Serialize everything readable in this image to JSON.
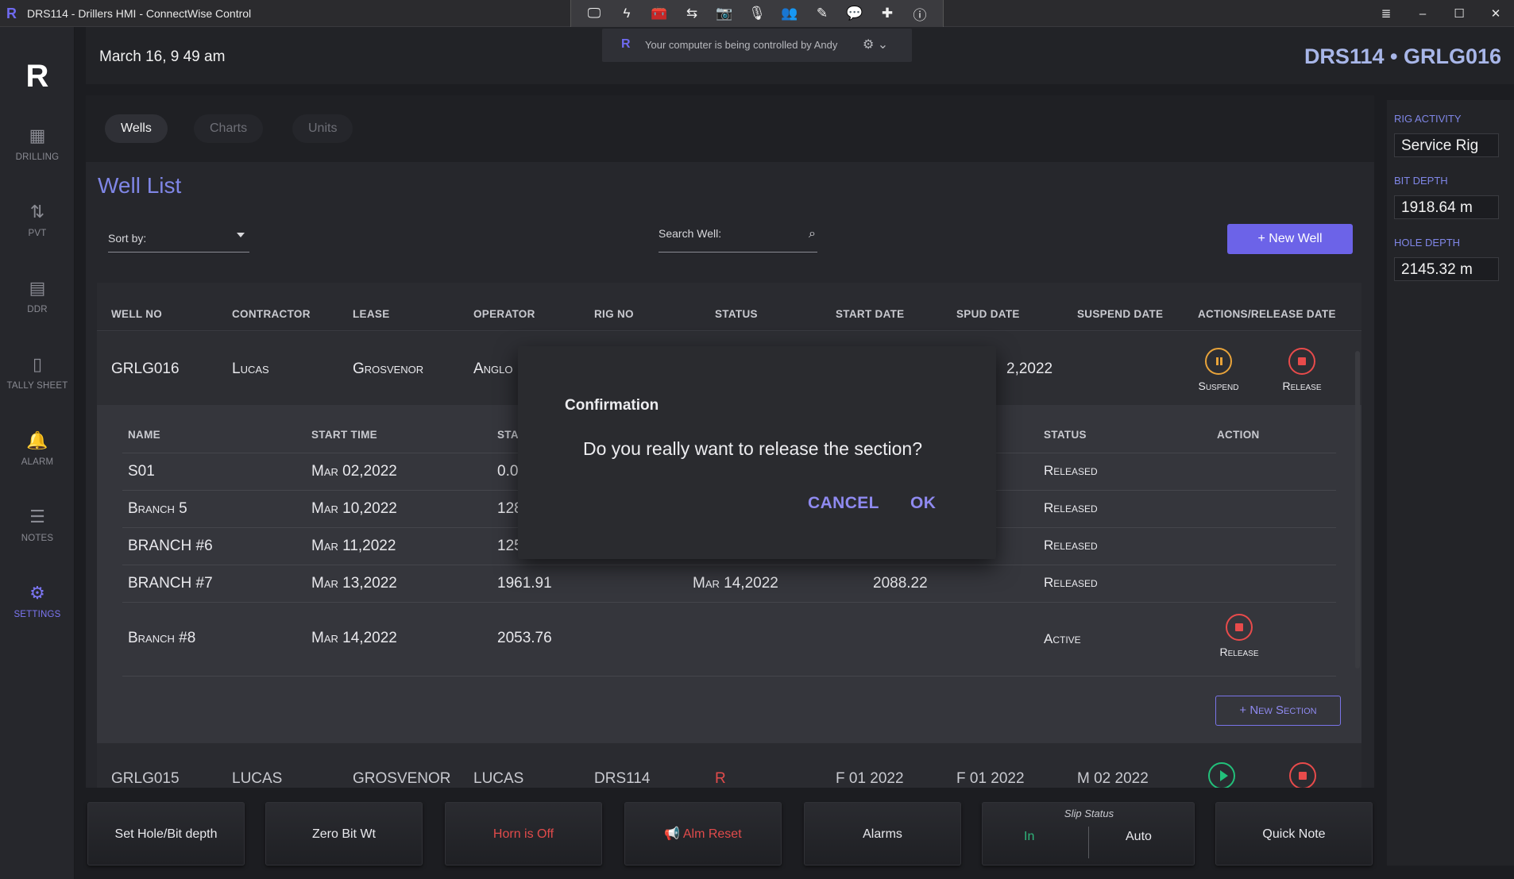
{
  "window": {
    "logo": "R",
    "title": "DRS114 - Drillers HMI - ConnectWise Control"
  },
  "cw_toolbar": {
    "icons": [
      "monitor-icon",
      "lightning-icon",
      "toolbox-icon",
      "transfer-icon",
      "camera-icon",
      "microphone-icon",
      "users-icon",
      "pencil-icon",
      "chat-icon",
      "plus-cross-icon",
      "info-icon"
    ]
  },
  "window_controls": {
    "menu": "≣",
    "minimize": "–",
    "maximize": "☐",
    "close": "✕"
  },
  "cw_banner": {
    "logo": "R",
    "text": "Your computer is being controlled by Andy",
    "gear": "⚙ ⌄"
  },
  "nav": {
    "brand": "R",
    "items": [
      {
        "label": "DRILLING",
        "icon": "▦"
      },
      {
        "label": "PVT",
        "icon": "⇅"
      },
      {
        "label": "DDR",
        "icon": "▤"
      },
      {
        "label": "TALLY SHEET",
        "icon": "▯"
      },
      {
        "label": "ALARM",
        "icon": "🔔"
      },
      {
        "label": "NOTES",
        "icon": "☰"
      },
      {
        "label": "SETTINGS",
        "icon": "⚙"
      }
    ]
  },
  "header": {
    "date": "March 16, 9 49 am",
    "rig_well": "DRS114 • GRLG016"
  },
  "tabs": [
    "Wells",
    "Charts",
    "Units"
  ],
  "page": {
    "title": "Well List",
    "sort_label": "Sort by:",
    "search_label": "Search Well:",
    "search_icon": "⌕",
    "new_well": "+ New Well"
  },
  "well_table": {
    "columns": [
      "WELL NO",
      "CONTRACTOR",
      "LEASE",
      "OPERATOR",
      "RIG NO",
      "STATUS",
      "START DATE",
      "SPUD DATE",
      "SUSPEND DATE",
      "ACTIONS/RELEASE DATE"
    ],
    "well": {
      "well_no": "GRLG016",
      "contractor": "Lucas",
      "lease": "Grosvenor",
      "operator": "Anglo",
      "spud_partial": "2,2022"
    },
    "actions": {
      "suspend": "Suspend",
      "release": "Release"
    }
  },
  "sections": {
    "columns": [
      "NAME",
      "START TIME",
      "STAR",
      "STATUS",
      "ACTION"
    ],
    "rows": [
      {
        "name": "S01",
        "start_time": "Mar 02,2022",
        "start_depth": "0.0",
        "end_time": "",
        "end_depth": "",
        "status": "Released"
      },
      {
        "name": "Branch 5",
        "start_time": "Mar 10,2022",
        "start_depth": "128",
        "end_time": "",
        "end_depth": "",
        "status": "Released"
      },
      {
        "name": "BRANCH #6",
        "start_time": "Mar 11,2022",
        "start_depth": "125",
        "end_time": "",
        "end_depth": "",
        "status": "Released"
      },
      {
        "name": "BRANCH #7",
        "start_time": "Mar 13,2022",
        "start_depth": "1961.91",
        "end_time": "Mar 14,2022",
        "end_depth": "2088.22",
        "status": "Released"
      },
      {
        "name": "Branch #8",
        "start_time": "Mar 14,2022",
        "start_depth": "2053.76",
        "end_time": "",
        "end_depth": "",
        "status": "Active"
      }
    ],
    "row_action_release": "Release",
    "new_section": "+ New Section"
  },
  "next_well_partial": [
    "GRLG015",
    "LUCAS",
    "GROSVENOR",
    "LUCAS",
    "DRS114",
    "R",
    "F 01 2022",
    "F 01 2022",
    "M 02 2022"
  ],
  "dialog": {
    "title": "Confirmation",
    "message": "Do you really want to release the section?",
    "cancel": "CANCEL",
    "ok": "OK"
  },
  "right_panel": {
    "rig_activity_label": "RIG ACTIVITY",
    "rig_activity": "Service Rig",
    "bit_depth_label": "BIT DEPTH",
    "bit_depth": "1918.64 m",
    "hole_depth_label": "HOLE DEPTH",
    "hole_depth": "2145.32 m"
  },
  "bottom_bar": {
    "set_hole": "Set Hole/Bit depth",
    "zero_bit": "Zero Bit Wt",
    "horn": "Horn is Off",
    "alm_reset": "Alm Reset",
    "alarms": "Alarms",
    "slip_title": "Slip Status",
    "slip_in": "In",
    "slip_auto": "Auto",
    "quick_note": "Quick Note"
  },
  "colors": {
    "accent": "#6c63e8",
    "released": "#e14b4b",
    "active": "#2fb57a",
    "suspend": "#e8a33a"
  }
}
